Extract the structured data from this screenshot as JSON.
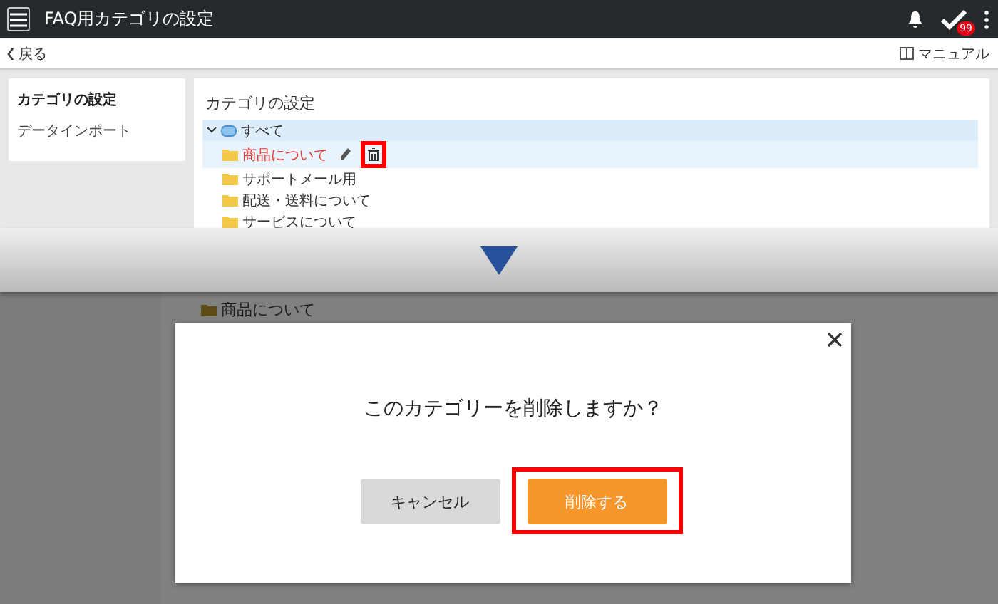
{
  "before": {
    "header": {
      "title": "FAQ用カテゴリの設定",
      "badge": "99"
    },
    "subbar": {
      "back": "戻る",
      "manual": "マニュアル"
    },
    "sidebar": {
      "items": [
        {
          "label": "カテゴリの設定",
          "selected": true
        },
        {
          "label": "データインポート",
          "selected": false
        }
      ]
    },
    "panel": {
      "title": "カテゴリの設定",
      "tree": {
        "label": "すべて",
        "expanded": true,
        "selected": true,
        "children": [
          {
            "label": "商品について",
            "selected": true,
            "delete_marked": true
          },
          {
            "label": "サポートメール用",
            "selected": false
          },
          {
            "label": "配送・送料について",
            "selected": false
          },
          {
            "label": "サービスについて",
            "selected": false
          }
        ]
      }
    }
  },
  "after": {
    "background_item": "商品について",
    "dialog": {
      "message": "このカテゴリーを削除しますか？",
      "buttons": [
        {
          "label": "キャンセル",
          "kind": "cancel",
          "marked": false
        },
        {
          "label": "削除する",
          "kind": "confirm",
          "marked": true
        }
      ]
    }
  }
}
